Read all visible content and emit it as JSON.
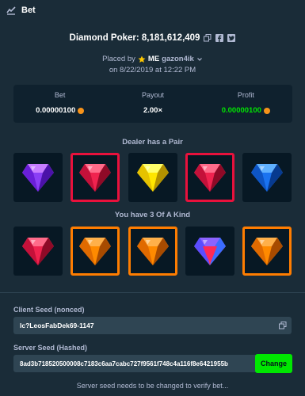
{
  "titlebar": {
    "title": "Bet",
    "icon": "bet-slip-icon"
  },
  "header": {
    "game_title": "Diamond Poker: 8,181,612,409",
    "placed_by_prefix": "Placed by",
    "badge": "ME",
    "username": "gazon4ik",
    "date": "on 8/22/2019 at 12:22 PM"
  },
  "stats": {
    "bet_label": "Bet",
    "bet_value": "0.00000100",
    "payout_label": "Payout",
    "payout_value": "2.00×",
    "profit_label": "Profit",
    "profit_value": "0.00000100"
  },
  "dealer": {
    "label": "Dealer has a Pair",
    "gems": [
      {
        "color": "purple",
        "highlight": "none"
      },
      {
        "color": "red",
        "highlight": "red"
      },
      {
        "color": "yellow",
        "highlight": "none"
      },
      {
        "color": "red",
        "highlight": "red"
      },
      {
        "color": "blue",
        "highlight": "none"
      }
    ]
  },
  "player": {
    "label": "You have 3 Of A Kind",
    "gems": [
      {
        "color": "red",
        "highlight": "none"
      },
      {
        "color": "orange",
        "highlight": "orange"
      },
      {
        "color": "orange",
        "highlight": "orange"
      },
      {
        "color": "multicolor",
        "highlight": "none"
      },
      {
        "color": "orange",
        "highlight": "orange"
      }
    ]
  },
  "seeds": {
    "client_label": "Client Seed (nonced)",
    "client_value": "lc?LeosFabDek69-1147",
    "server_label": "Server Seed (Hashed)",
    "server_value": "8ad3b718520500008c7183c6aa7cabc727f9561f748c4a116f8e6421955b",
    "change_label": "Change",
    "hint": "Server seed needs to be changed to verify bet..."
  },
  "colors": {
    "background": "#1a2c38",
    "panel": "#0f212e",
    "input": "#2f4553",
    "accent_green": "#00e701",
    "highlight_red": "#e9113c",
    "highlight_orange": "#ff7d00"
  }
}
